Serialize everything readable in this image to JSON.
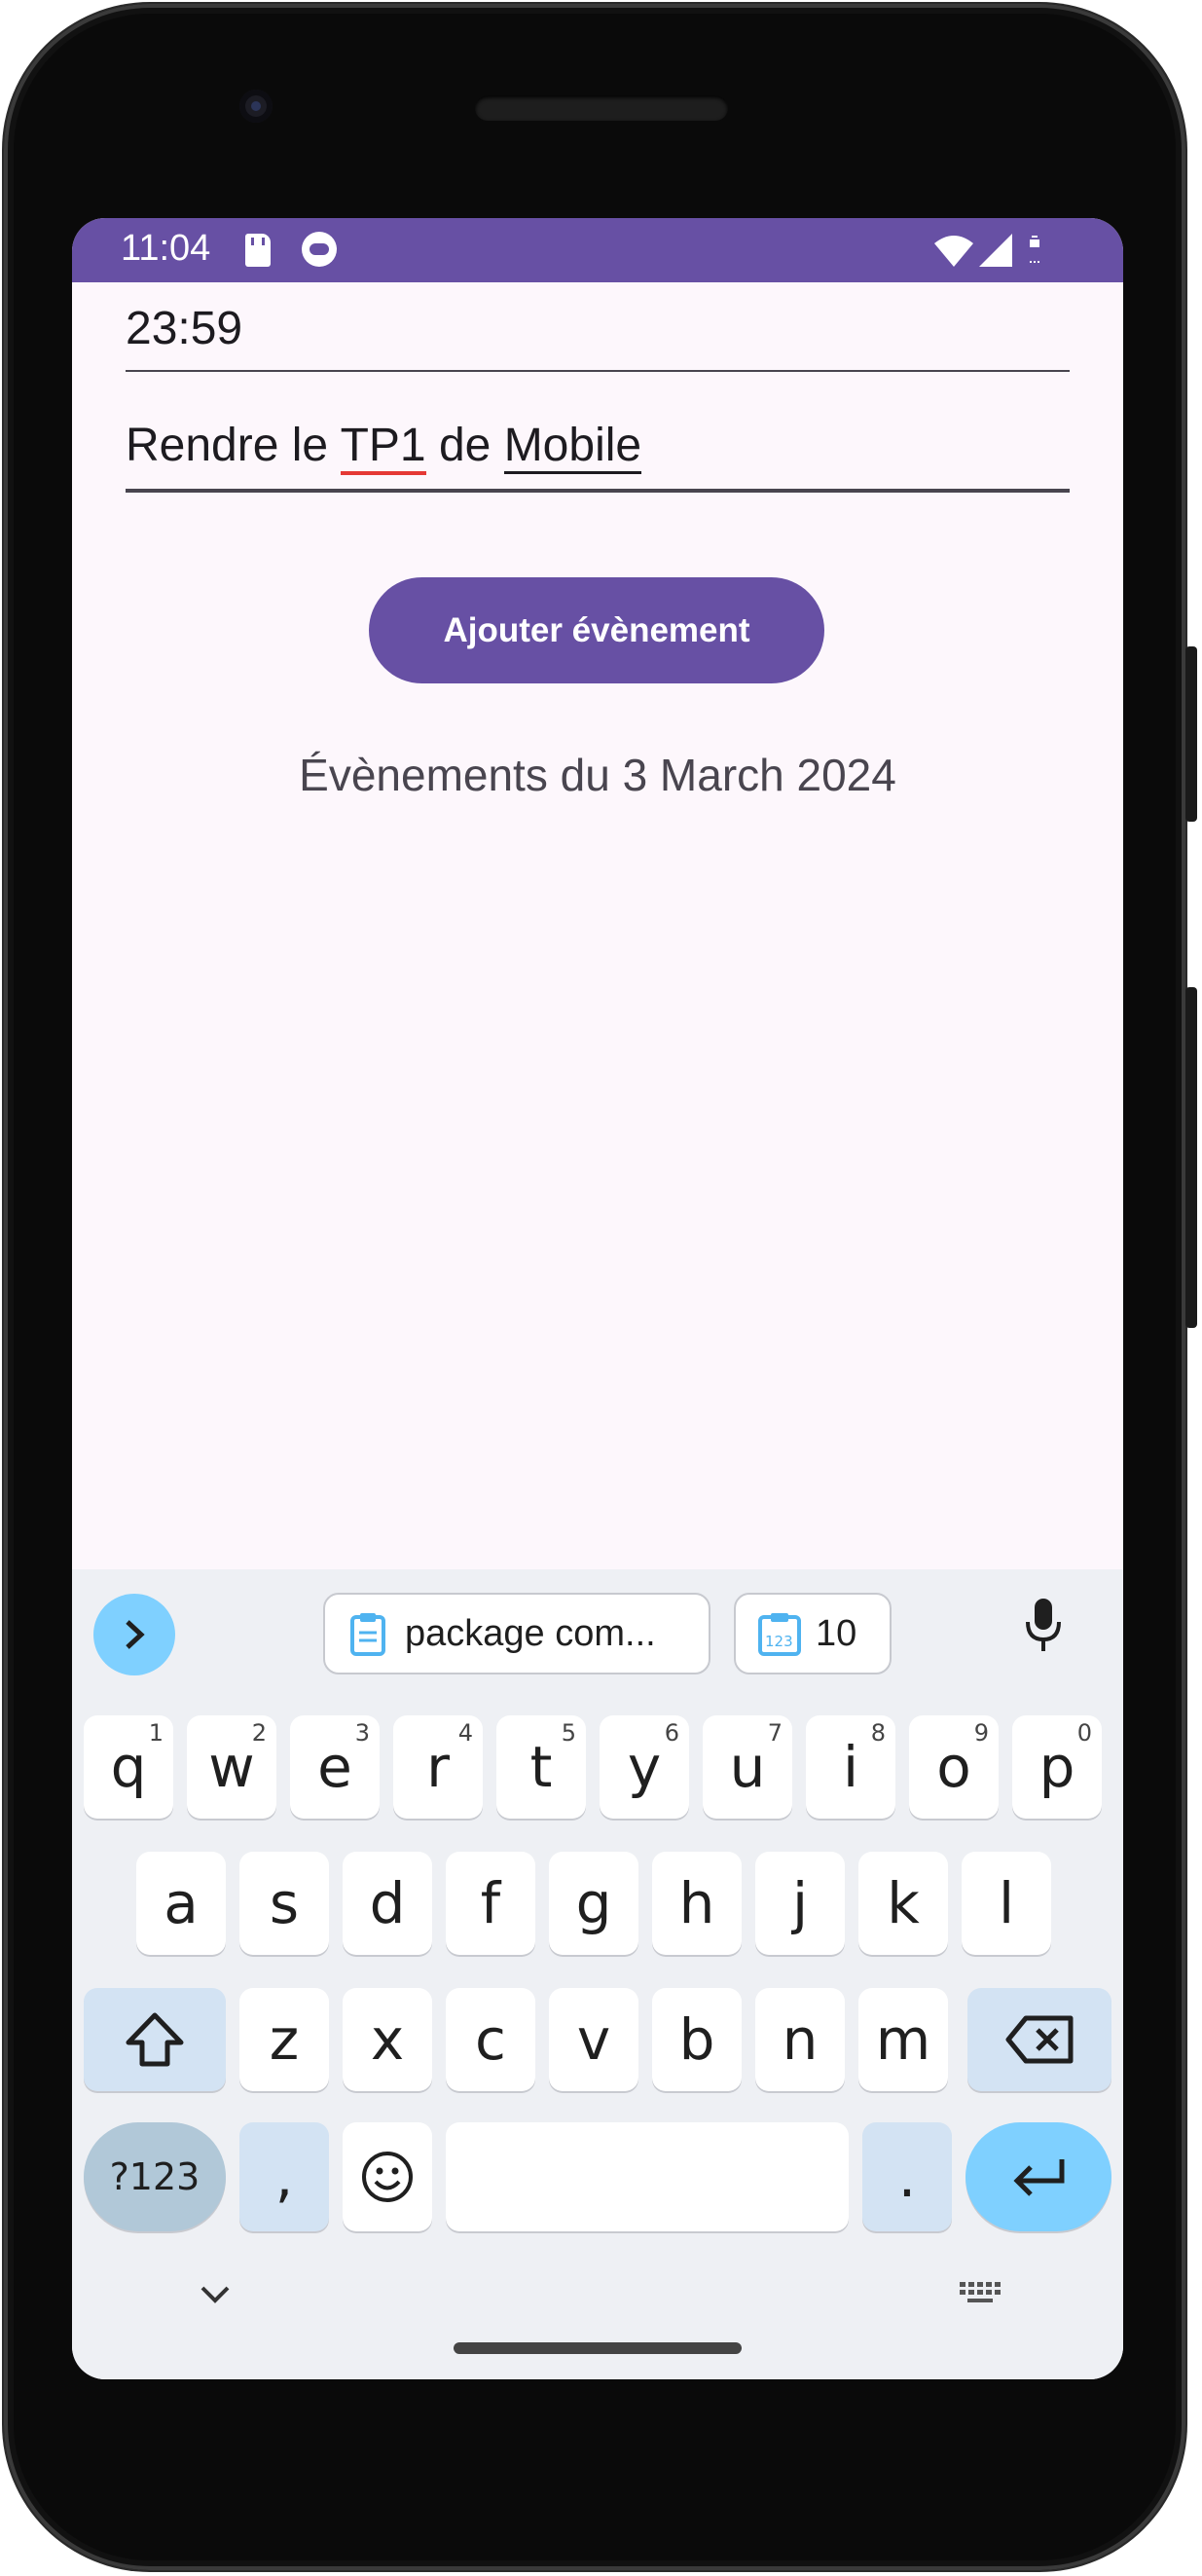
{
  "status_bar": {
    "time": "11:04",
    "color": "#6750a4"
  },
  "form": {
    "time_value": "23:59",
    "event_text_parts": [
      "Rendre le ",
      "TP1",
      " de ",
      "Mobile"
    ],
    "add_button_label": "Ajouter évènement"
  },
  "events": {
    "title": "Évènements du 3 March 2024"
  },
  "keyboard": {
    "suggestion_clip": "package com...",
    "suggestion_count": "10",
    "row1": [
      {
        "k": "q",
        "h": "1"
      },
      {
        "k": "w",
        "h": "2"
      },
      {
        "k": "e",
        "h": "3"
      },
      {
        "k": "r",
        "h": "4"
      },
      {
        "k": "t",
        "h": "5"
      },
      {
        "k": "y",
        "h": "6"
      },
      {
        "k": "u",
        "h": "7"
      },
      {
        "k": "i",
        "h": "8"
      },
      {
        "k": "o",
        "h": "9"
      },
      {
        "k": "p",
        "h": "0"
      }
    ],
    "row2": [
      "a",
      "s",
      "d",
      "f",
      "g",
      "h",
      "j",
      "k",
      "l"
    ],
    "row3": [
      "z",
      "x",
      "c",
      "v",
      "b",
      "n",
      "m"
    ],
    "symbols_label": "?123",
    "comma": ",",
    "period": ".",
    "accent_color": "#7fd0ff"
  }
}
